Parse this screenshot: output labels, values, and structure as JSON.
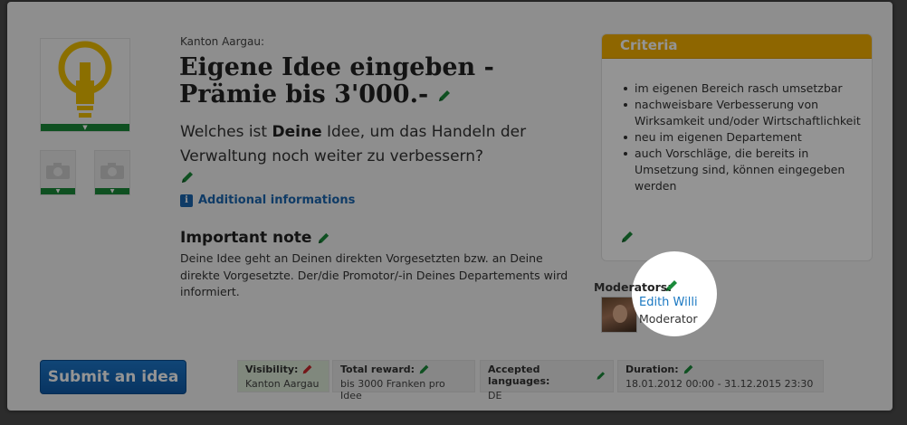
{
  "idea": {
    "org": "Kanton Aargau:",
    "title": "Eigene Idee eingeben - Prämie bis 3'000.-",
    "question_pre": "Welches ist ",
    "question_bold": "Deine",
    "question_post": " Idee, um das Handeln der Verwaltung noch weiter zu verbessern?",
    "additional_info": "Additional informations"
  },
  "important": {
    "title": "Important note",
    "text": "Deine Idee geht an Deinen direkten Vorgesetzten bzw. an Deine direkte Vorgesetzte. Der/die Promotor/-in Deines Departements wird informiert."
  },
  "criteria": {
    "title": "Criteria",
    "items": [
      "im eigenen Bereich rasch umsetzbar",
      "nachweisbare Verbesserung von Wirksamkeit und/oder Wirtschaftlichkeit",
      "neu im eigenen Departement",
      "auch Vorschläge, die bereits in Umsetzung sind, können eingegeben werden"
    ]
  },
  "moderators": {
    "label": "Moderators:",
    "name": "Edith Willi",
    "role": "Moderator"
  },
  "submit_label": "Submit an idea",
  "meta": {
    "visibility_label": "Visibility:",
    "visibility_value": "Kanton Aargau",
    "reward_label": "Total reward:",
    "reward_value": "bis 3000 Franken pro Idee",
    "languages_label": "Accepted languages:",
    "languages_value": "DE",
    "duration_label": "Duration:",
    "duration_value": "18.01.2012 00:00 - 31.12.2015 23:30"
  },
  "colors": {
    "accent_blue": "#1a66b0",
    "criteria_orange": "#f5b000",
    "edit_green": "#1a8a3a",
    "edit_red": "#c8262b"
  }
}
